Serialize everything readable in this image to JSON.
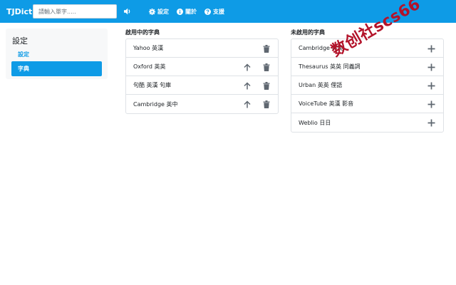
{
  "app": {
    "title": "TJDict"
  },
  "search": {
    "placeholder": "請輸入單字....."
  },
  "nav": {
    "settings": "設定",
    "about": "關於",
    "support": "支援"
  },
  "sidebar": {
    "title": "設定",
    "items": [
      {
        "label": "設定",
        "active": false
      },
      {
        "label": "字典",
        "active": true
      }
    ]
  },
  "enabled": {
    "title": "啟用中的字典",
    "items": [
      {
        "label": "Yahoo 英漢"
      },
      {
        "label": "Oxford 英英"
      },
      {
        "label": "句酷 英漢 句庫"
      },
      {
        "label": "Cambridge 英中"
      }
    ]
  },
  "disabled": {
    "title": "未啟用的字典",
    "items": [
      {
        "label": "Cambridge 英英"
      },
      {
        "label": "Thesaurus 英英 同義詞"
      },
      {
        "label": "Urban 英英 俚語"
      },
      {
        "label": "VoiceTube 英漢 影音"
      },
      {
        "label": "Weblio 日日"
      }
    ]
  },
  "watermark": {
    "text": "数创社scs66"
  },
  "colors": {
    "primary": "#0e9be6",
    "icon": "#5f6770",
    "watermark": "#b3132a"
  }
}
